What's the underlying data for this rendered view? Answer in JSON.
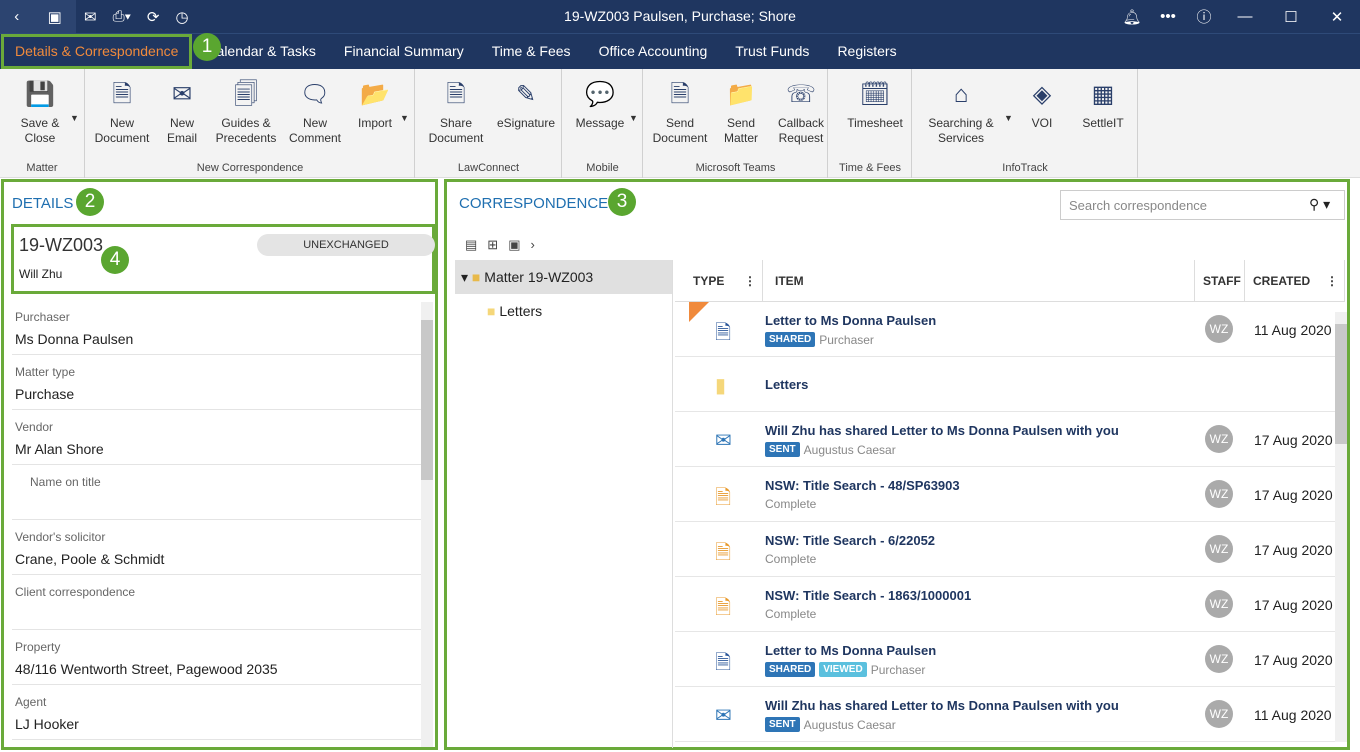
{
  "titlebar": {
    "title": "19-WZ003 Paulsen, Purchase; Shore",
    "icons": [
      "back-icon",
      "matter-folder-icon",
      "mail-icon",
      "print-icon",
      "refresh-icon",
      "clock-icon",
      "bell-icon",
      "more-icon",
      "help-icon",
      "minimize-icon",
      "maximize-icon",
      "close-icon"
    ]
  },
  "tabs": [
    "Details & Correspondence",
    "Calendar & Tasks",
    "Financial Summary",
    "Time & Fees",
    "Office Accounting",
    "Trust Funds",
    "Registers"
  ],
  "annotations": [
    "1",
    "2",
    "3",
    "4"
  ],
  "ribbon": {
    "groups": [
      "Matter",
      "New Correspondence",
      "LawConnect",
      "Mobile",
      "Microsoft Teams",
      "Time & Fees",
      "InfoTrack"
    ],
    "buttons": [
      {
        "l1": "Save &",
        "l2": "Close"
      },
      {
        "l1": "New",
        "l2": "Document"
      },
      {
        "l1": "New",
        "l2": "Email"
      },
      {
        "l1": "Guides &",
        "l2": "Precedents"
      },
      {
        "l1": "New",
        "l2": "Comment"
      },
      {
        "l1": "Import",
        "l2": ""
      },
      {
        "l1": "Share",
        "l2": "Document"
      },
      {
        "l1": "eSignature",
        "l2": ""
      },
      {
        "l1": "Message",
        "l2": ""
      },
      {
        "l1": "Send",
        "l2": "Document"
      },
      {
        "l1": "Send",
        "l2": "Matter"
      },
      {
        "l1": "Callback",
        "l2": "Request"
      },
      {
        "l1": "Timesheet",
        "l2": ""
      },
      {
        "l1": "Searching &",
        "l2": "Services"
      },
      {
        "l1": "VOI",
        "l2": ""
      },
      {
        "l1": "SettleIT",
        "l2": ""
      }
    ]
  },
  "details": {
    "heading": "DETAILS",
    "matter_id": "19-WZ003",
    "status": "UNEXCHANGED",
    "owner": "Will Zhu",
    "fields": [
      {
        "label": "Purchaser",
        "value": "Ms Donna Paulsen"
      },
      {
        "label": "Matter type",
        "value": "Purchase"
      },
      {
        "label": "Vendor",
        "value": "Mr Alan Shore"
      },
      {
        "label": "Name on title",
        "value": ""
      },
      {
        "label": "Vendor's solicitor",
        "value": "Crane, Poole & Schmidt"
      },
      {
        "label": "Client correspondence",
        "value": ""
      },
      {
        "label": "Property",
        "value": "48/116 Wentworth Street, Pagewood 2035"
      },
      {
        "label": "Agent",
        "value": "LJ Hooker"
      }
    ]
  },
  "correspondence": {
    "heading": "CORRESPONDENCE",
    "search_placeholder": "Search correspondence",
    "tree": [
      {
        "label": "Matter 19-WZ003"
      },
      {
        "label": "Letters"
      }
    ],
    "columns": [
      "TYPE",
      "ITEM",
      "STAFF",
      "CREATED"
    ],
    "rows": [
      {
        "type": "word-doc",
        "title": "Letter to Ms Donna Paulsen",
        "tags": [
          "SHARED"
        ],
        "sub": "Purchaser",
        "staff": "WZ",
        "created": "11 Aug 2020"
      },
      {
        "type": "folder",
        "title": "Letters",
        "tags": [],
        "sub": "",
        "staff": "",
        "created": ""
      },
      {
        "type": "email-sent",
        "title": "Will Zhu has shared Letter to Ms Donna Paulsen with you",
        "tags": [
          "SENT"
        ],
        "sub": "Augustus Caesar",
        "staff": "WZ",
        "created": "17 Aug 2020"
      },
      {
        "type": "search-doc",
        "title": "NSW: Title Search - 48/SP63903",
        "tags": [],
        "sub": "Complete",
        "staff": "WZ",
        "created": "17 Aug 2020"
      },
      {
        "type": "search-doc",
        "title": "NSW: Title Search - 6/22052",
        "tags": [],
        "sub": "Complete",
        "staff": "WZ",
        "created": "17 Aug 2020"
      },
      {
        "type": "search-doc",
        "title": "NSW: Title Search - 1863/1000001",
        "tags": [],
        "sub": "Complete",
        "staff": "WZ",
        "created": "17 Aug 2020"
      },
      {
        "type": "word-doc",
        "title": "Letter to Ms Donna Paulsen",
        "tags": [
          "SHARED",
          "VIEWED"
        ],
        "sub": "Purchaser",
        "staff": "WZ",
        "created": "17 Aug 2020"
      },
      {
        "type": "email-sent",
        "title": "Will Zhu has shared Letter to Ms Donna Paulsen with you",
        "tags": [
          "SENT"
        ],
        "sub": "Augustus Caesar",
        "staff": "WZ",
        "created": "11 Aug 2020"
      }
    ]
  },
  "colors": {
    "titlebar": "#1f3660",
    "active_tab": "#f08a3c",
    "annotation": "#5aa630",
    "tag": "#2e75b6",
    "tag_viewed": "#5bc0de"
  }
}
